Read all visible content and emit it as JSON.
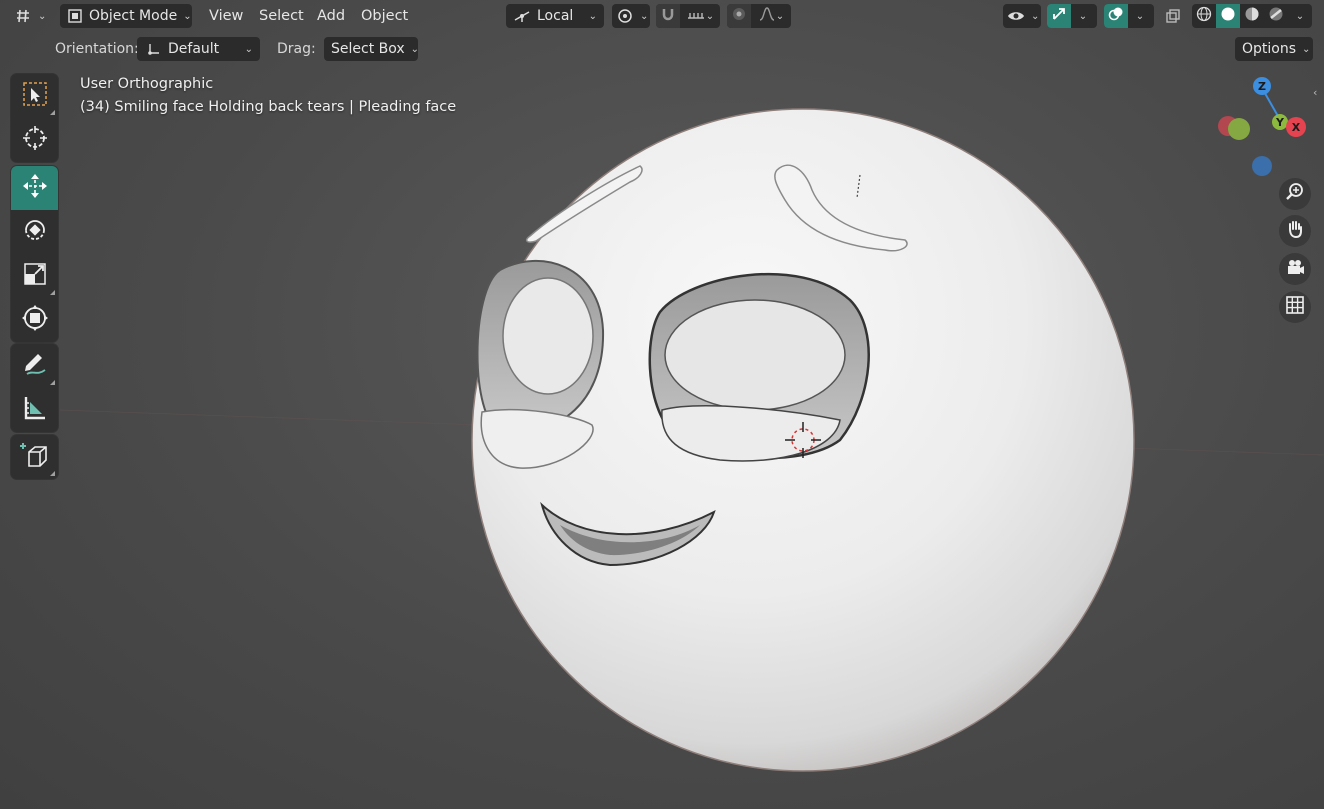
{
  "header": {
    "mode": "Object Mode",
    "menus": [
      "View",
      "Select",
      "Add",
      "Object"
    ],
    "transform_orientation": "Local",
    "options_label": "Options"
  },
  "tool_settings": {
    "orientation_label": "Orientation:",
    "orientation_value": "Default",
    "drag_label": "Drag:",
    "drag_value": "Select Box"
  },
  "viewport": {
    "view_name": "User Orthographic",
    "object_info": "(34) Smiling face Holding back tears | Pleading face"
  },
  "gizmo": {
    "axes": [
      "Z",
      "Y",
      "X"
    ],
    "colors": {
      "x": "#e5434f",
      "y": "#8cba3e",
      "z": "#3b8ee0"
    }
  },
  "toolbar": {
    "tools": [
      "select-box",
      "cursor",
      "move",
      "rotate",
      "scale",
      "transform",
      "annotate",
      "measure",
      "add-cube"
    ],
    "active_tool": "move",
    "accent": "#2a8374"
  },
  "nav_buttons": [
    "zoom",
    "pan",
    "camera",
    "ortho-grid"
  ]
}
